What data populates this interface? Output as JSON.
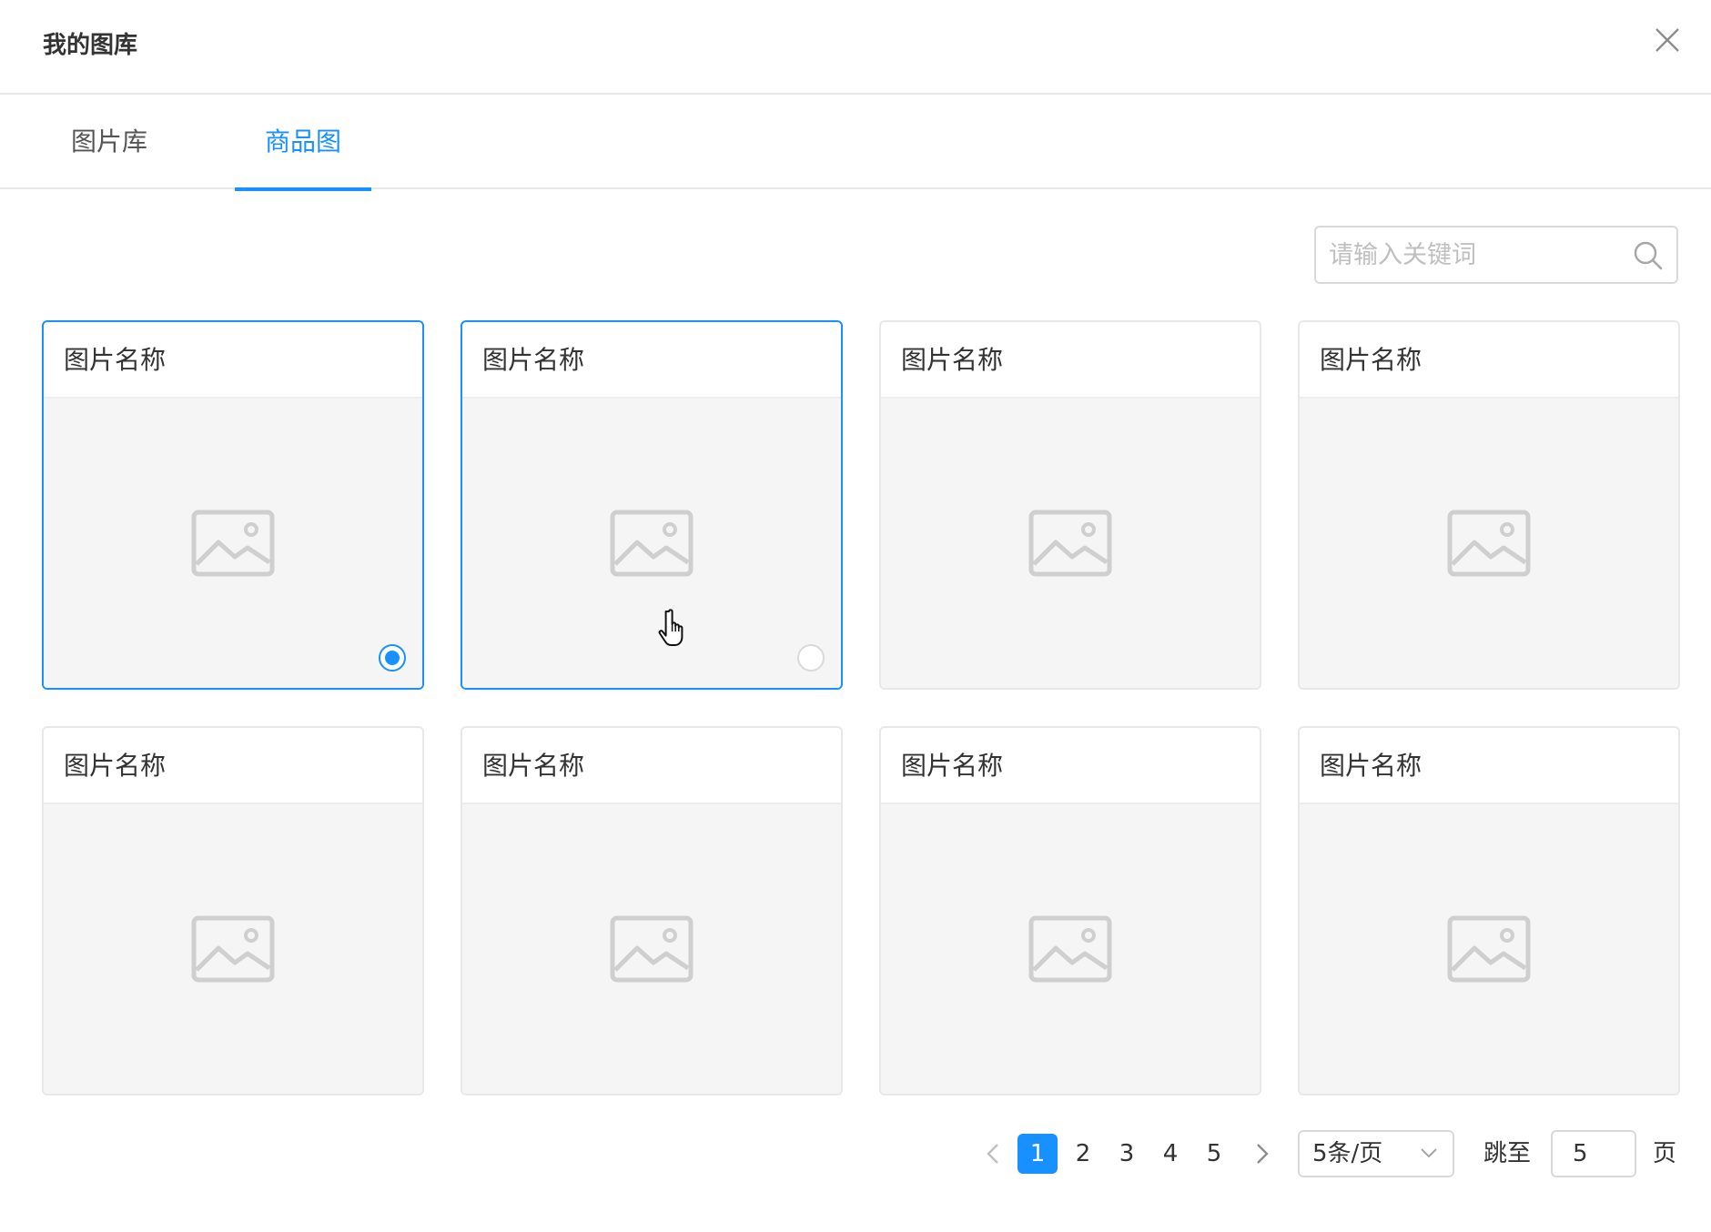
{
  "dialog": {
    "title": "我的图库",
    "close_icon": "close-icon"
  },
  "tabs": [
    {
      "label": "图片库",
      "active": false
    },
    {
      "label": "商品图",
      "active": true
    }
  ],
  "search": {
    "placeholder": "请输入关键词",
    "icon": "search-icon"
  },
  "cards": [
    {
      "title": "图片名称",
      "selected": true,
      "radio": "checked",
      "hover": false
    },
    {
      "title": "图片名称",
      "selected": false,
      "radio": "unchecked",
      "hover": true
    },
    {
      "title": "图片名称",
      "selected": false,
      "radio": null,
      "hover": false
    },
    {
      "title": "图片名称",
      "selected": false,
      "radio": null,
      "hover": false
    },
    {
      "title": "图片名称",
      "selected": false,
      "radio": null,
      "hover": false
    },
    {
      "title": "图片名称",
      "selected": false,
      "radio": null,
      "hover": false
    },
    {
      "title": "图片名称",
      "selected": false,
      "radio": null,
      "hover": false
    },
    {
      "title": "图片名称",
      "selected": false,
      "radio": null,
      "hover": false
    }
  ],
  "pagination": {
    "pages": [
      "1",
      "2",
      "3",
      "4",
      "5"
    ],
    "current": "1",
    "page_size": "5条/页",
    "goto_label": "跳至",
    "goto_value": "5",
    "page_label": "页"
  },
  "colors": {
    "accent": "#1890ff",
    "border": "#e8e8e8",
    "placeholder_bg": "#f5f5f5"
  }
}
